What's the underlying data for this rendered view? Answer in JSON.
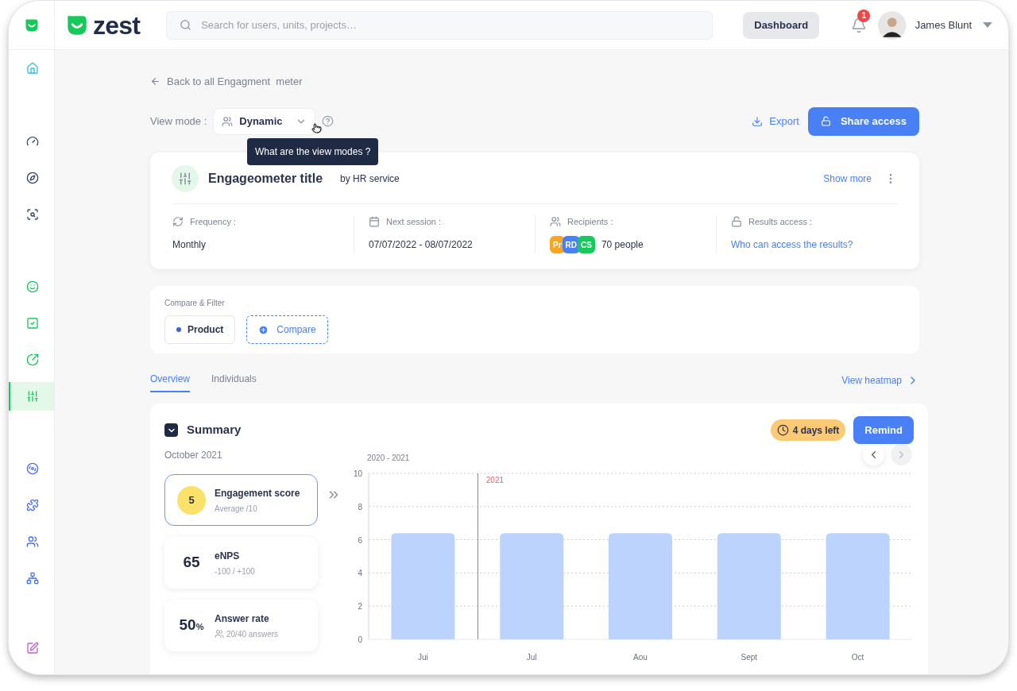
{
  "app": {
    "logo_text": "zest"
  },
  "search": {
    "placeholder": "Search for users, units, projects…"
  },
  "header": {
    "dashboard_button": "Dashboard",
    "notification_count": "1",
    "user_name": "James Blunt"
  },
  "sidebar": {
    "groups": [
      [
        {
          "selected": false
        }
      ],
      [
        {
          "selected": false
        },
        {
          "selected": false
        },
        {
          "selected": false
        }
      ],
      [
        {
          "selected": false
        },
        {
          "selected": false
        },
        {
          "selected": false
        },
        {
          "selected": true
        }
      ],
      [
        {
          "selected": false
        },
        {
          "selected": false
        },
        {
          "selected": false
        },
        {
          "selected": false
        }
      ],
      [
        {
          "selected": false
        }
      ]
    ]
  },
  "back_link": "Back to all Engagment  meter",
  "view_mode": {
    "label": "View mode :",
    "value": "Dynamic",
    "tooltip": "What are the view modes ?"
  },
  "actions": {
    "export": "Export",
    "share": "Share access"
  },
  "engageometer": {
    "title": "Engageometer title",
    "byline": "by HR service",
    "show_more": "Show more",
    "fields": [
      {
        "kind": "text",
        "label": "Frequency :",
        "value": "Monthly"
      },
      {
        "kind": "text",
        "label": "Next session :",
        "value": "07/07/2022 - 08/07/2022"
      },
      {
        "kind": "recipients",
        "label": "Recipients :",
        "chips": [
          {
            "text": "Pr",
            "color": "#f5a623"
          },
          {
            "text": "RD",
            "color": "#4a80f5"
          },
          {
            "text": "CS",
            "color": "#16c95a"
          }
        ],
        "value": "70 people"
      },
      {
        "kind": "link",
        "label": "Results access :",
        "value": "Who can access the results?"
      }
    ]
  },
  "filter": {
    "label": "Compare & Filter",
    "chips": [
      {
        "text": "Product"
      }
    ],
    "compare": "Compare"
  },
  "tabs": [
    {
      "label": "Overview",
      "selected": true
    },
    {
      "label": "Individuals",
      "selected": false
    }
  ],
  "heatmap_link": "View heatmap",
  "summary": {
    "title": "Summary",
    "expanded": true,
    "period": "October 2021",
    "badge": "4 days left",
    "remind": "Remind",
    "metrics": [
      {
        "kind": "score",
        "value": "5",
        "title": "Engagement score",
        "subtitle": "Average /10",
        "selected": true
      },
      {
        "kind": "number",
        "value": "65",
        "title": "eNPS",
        "subtitle": "-100 / +100",
        "selected": false
      },
      {
        "kind": "percent",
        "value": "50",
        "unit": "%",
        "title": "Answer rate",
        "subtitle": "20/40 answers",
        "selected": false
      }
    ],
    "chart_nav": {
      "prev_disabled": false,
      "next_disabled": true
    },
    "chart_data": {
      "type": "bar",
      "title": "2020 - 2021",
      "categories": [
        "Jui",
        "Jul",
        "Aou",
        "Sept",
        "Oct"
      ],
      "values": [
        6.4,
        6.4,
        6.4,
        6.4,
        6.4
      ],
      "ylim": [
        0,
        10
      ],
      "yticks": [
        0,
        2,
        4,
        6,
        8,
        10
      ],
      "grid": true,
      "annotations": [
        "2021"
      ]
    }
  }
}
